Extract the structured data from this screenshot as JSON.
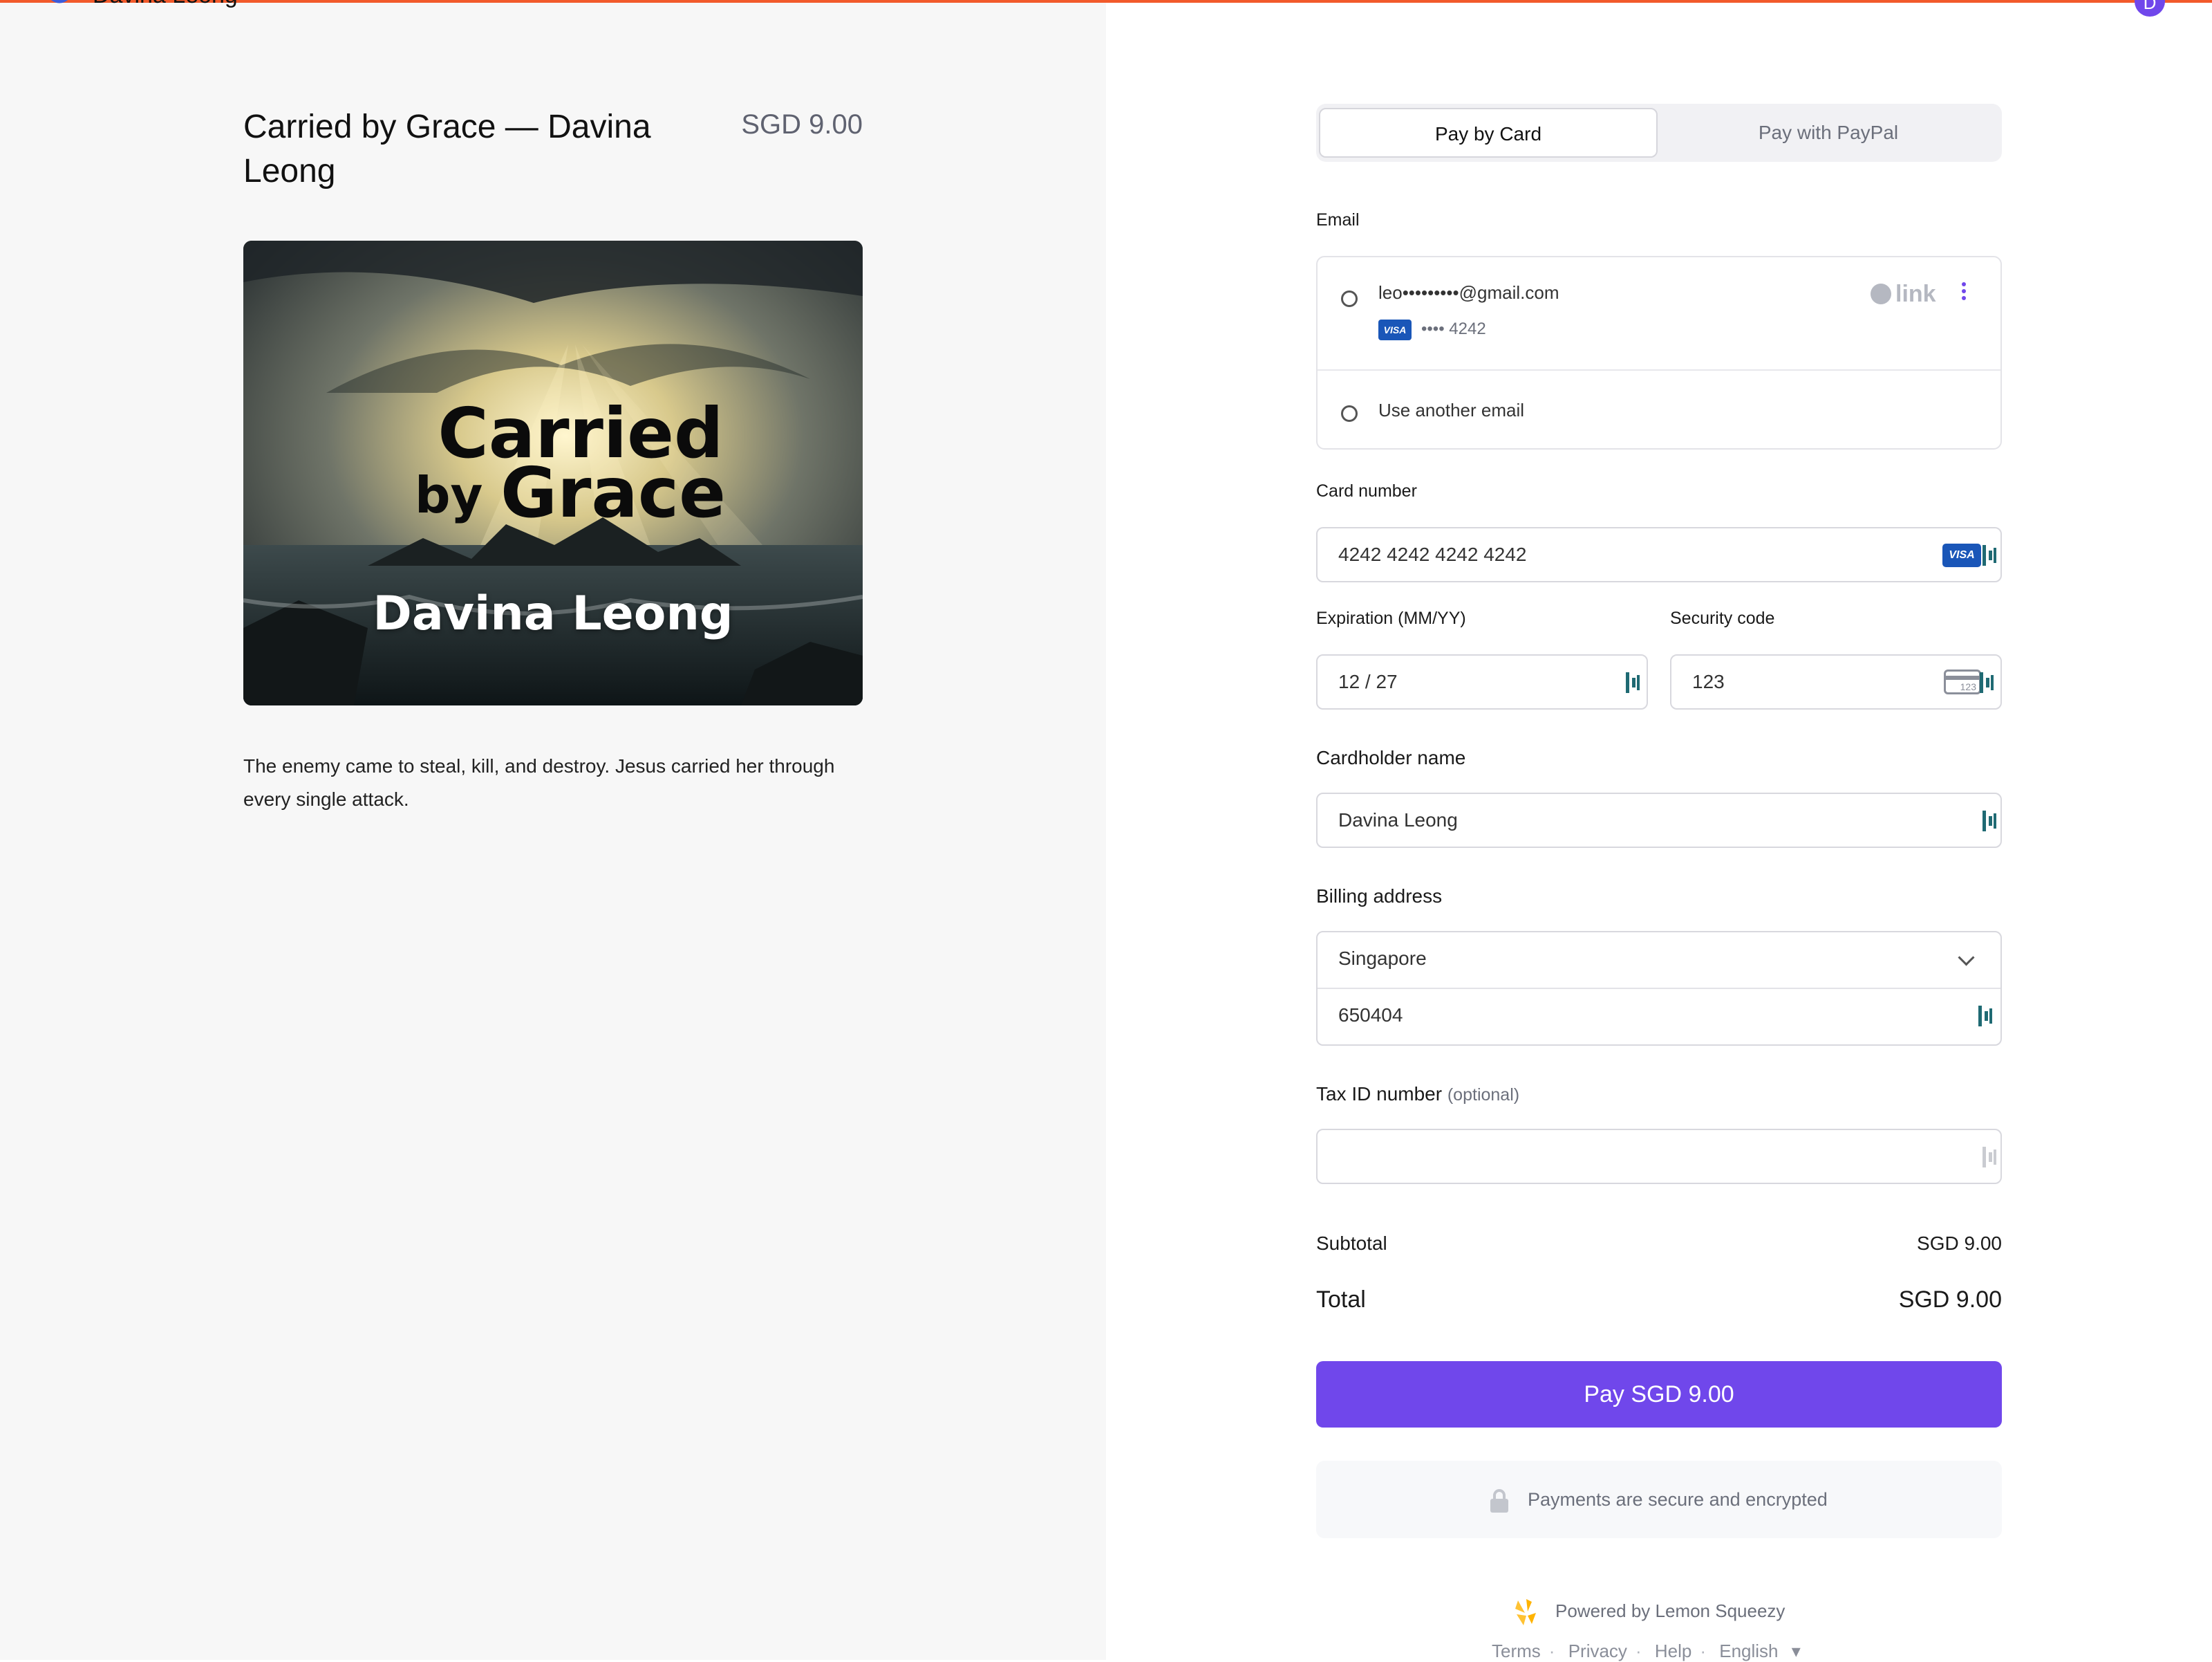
{
  "header": {
    "store_name": "Davina Leong",
    "avatar_letter": "D",
    "accent_color": "#f25a2b"
  },
  "product": {
    "title": "Carried by Grace — Davina Leong",
    "price": "SGD 9.00",
    "cover": {
      "line1": "Carried",
      "line2_by": "by",
      "line2_word": "Grace",
      "author": "Davina Leong"
    },
    "description": "The enemy came to steal, kill, and destroy. Jesus carried her through every single attack."
  },
  "payment_tabs": {
    "card": "Pay by Card",
    "paypal": "Pay with PayPal",
    "selected": "card"
  },
  "email": {
    "label": "Email",
    "saved_email": "leo•••••••••@gmail.com",
    "card_brand": "VISA",
    "card_last4": "•••• 4242",
    "link_brand": "link",
    "another_email": "Use another email"
  },
  "card": {
    "number_label": "Card number",
    "number_value": "4242 4242 4242 4242",
    "brand_badge": "VISA",
    "expiry_label": "Expiration (MM/YY)",
    "expiry_value": "12 / 27",
    "cvc_label": "Security code",
    "cvc_value": "123",
    "cvc_icon_text": "123"
  },
  "cardholder": {
    "label": "Cardholder name",
    "value": "Davina Leong"
  },
  "billing": {
    "label": "Billing address",
    "country": "Singapore",
    "postal_code": "650404"
  },
  "tax": {
    "label": "Tax ID number",
    "optional": "(optional)",
    "value": ""
  },
  "summary": {
    "subtotal_label": "Subtotal",
    "subtotal_value": "SGD 9.00",
    "total_label": "Total",
    "total_value": "SGD 9.00"
  },
  "pay_button": {
    "label": "Pay SGD 9.00",
    "color": "#7047eb"
  },
  "secure_note": "Payments are secure and encrypted",
  "powered_by": "Powered by Lemon Squeezy",
  "footer": {
    "terms": "Terms",
    "privacy": "Privacy",
    "help": "Help",
    "language": "English"
  }
}
